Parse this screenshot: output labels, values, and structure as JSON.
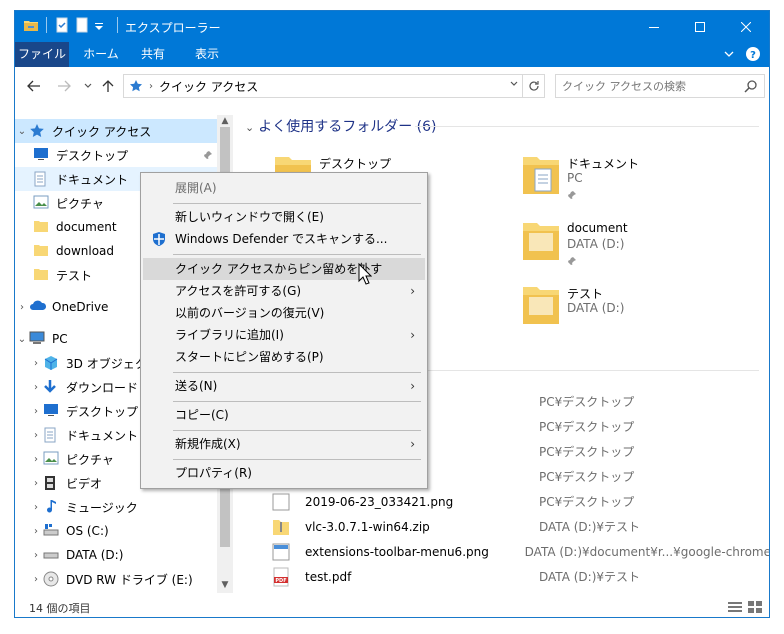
{
  "window": {
    "title": "エクスプローラー"
  },
  "ribbon": {
    "tabs": [
      "ファイル",
      "ホーム",
      "共有",
      "表示"
    ]
  },
  "address": {
    "crumb": "クイック アクセス",
    "search_placeholder": "クイック アクセスの検索"
  },
  "navpane": {
    "items": [
      {
        "label": "クイック アクセス",
        "icon": "star-icon"
      },
      {
        "label": "デスクトップ",
        "icon": "desktop-icon"
      },
      {
        "label": "ドキュメント",
        "icon": "document-icon"
      },
      {
        "label": "ピクチャ",
        "icon": "pictures-icon"
      },
      {
        "label": "document",
        "icon": "folder-icon"
      },
      {
        "label": "download",
        "icon": "folder-icon"
      },
      {
        "label": "テスト",
        "icon": "folder-icon"
      },
      {
        "label": "OneDrive",
        "icon": "cloud-icon"
      },
      {
        "label": "PC",
        "icon": "pc-icon"
      },
      {
        "label": "3D オブジェクト",
        "icon": "cube-icon"
      },
      {
        "label": "ダウンロード",
        "icon": "download-arrow-icon"
      },
      {
        "label": "デスクトップ",
        "icon": "desktop-icon"
      },
      {
        "label": "ドキュメント",
        "icon": "document-icon"
      },
      {
        "label": "ピクチャ",
        "icon": "pictures-icon"
      },
      {
        "label": "ビデオ",
        "icon": "video-icon"
      },
      {
        "label": "ミュージック",
        "icon": "music-icon"
      },
      {
        "label": "OS (C:)",
        "icon": "drive-c-icon"
      },
      {
        "label": "DATA (D:)",
        "icon": "drive-icon"
      },
      {
        "label": "DVD RW ドライブ (E:)",
        "icon": "dvd-icon"
      }
    ]
  },
  "content": {
    "frequent_title": "よく使用するフォルダー (6)",
    "folders": [
      {
        "name": "デスクトップ",
        "location": "PC"
      },
      {
        "name": "ドキュメント",
        "location": "PC"
      },
      {
        "name": "document",
        "location": "DATA (D:)"
      },
      {
        "name": "テスト",
        "location": "DATA (D:)"
      }
    ],
    "recent_files": [
      {
        "name": "",
        "path": "PC¥デスクトップ"
      },
      {
        "name": "",
        "path": "PC¥デスクトップ"
      },
      {
        "name": "",
        "path": "PC¥デスクトップ"
      },
      {
        "name": "",
        "path": "PC¥デスクトップ"
      },
      {
        "name": "2019-06-23_033421.png",
        "path": "PC¥デスクトップ"
      },
      {
        "name": "vlc-3.0.7.1-win64.zip",
        "path": "DATA (D:)¥テスト"
      },
      {
        "name": "extensions-toolbar-menu6.png",
        "path": "DATA (D:)¥document¥r...¥google-chrome"
      },
      {
        "name": "test.pdf",
        "path": "DATA (D:)¥テスト"
      }
    ]
  },
  "status": {
    "count": "14 個の項目"
  },
  "context_menu": {
    "items": [
      {
        "label": "展開(A)"
      },
      {
        "label": "新しいウィンドウで開く(E)"
      },
      {
        "label": "Windows Defender でスキャンする..."
      },
      {
        "label": "クイック アクセスからピン留めを外す"
      },
      {
        "label": "アクセスを許可する(G)"
      },
      {
        "label": "以前のバージョンの復元(V)"
      },
      {
        "label": "ライブラリに追加(I)"
      },
      {
        "label": "スタートにピン留めする(P)"
      },
      {
        "label": "送る(N)"
      },
      {
        "label": "コピー(C)"
      },
      {
        "label": "新規作成(X)"
      },
      {
        "label": "プロパティ(R)"
      }
    ]
  },
  "colors": {
    "titlebar": "#0078d7",
    "file_tab": "#19478a",
    "selection": "#cce8ff",
    "section_title": "#1e3287"
  }
}
